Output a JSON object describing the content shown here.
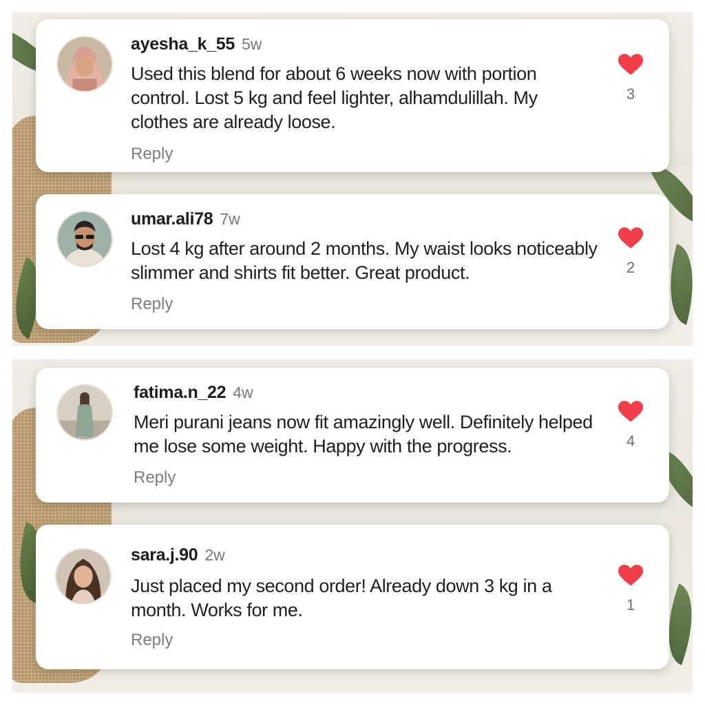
{
  "colors": {
    "heart": "#ef3e4a",
    "username": "#1d1d1d",
    "muted": "#777777"
  },
  "comments": [
    {
      "username": "ayesha_k_55",
      "time": "5w",
      "text": "Used this blend for about 6 weeks now with portion control. Lost 5 kg and feel lighter, alhamdulillah. My clothes are already loose.",
      "reply_label": "Reply",
      "likes": "3",
      "avatar": "woman-headscarf-avatar"
    },
    {
      "username": "umar.ali78",
      "time": "7w",
      "text": "Lost 4 kg after around 2 months. My waist looks noticeably slimmer and shirts fit better. Great product.",
      "reply_label": "Reply",
      "likes": "2",
      "avatar": "man-sunglasses-avatar"
    },
    {
      "username": "fatima.n_22",
      "time": "4w",
      "text": "Meri purani jeans now fit amazingly well. Definitely helped me lose some weight. Happy with the progress.",
      "reply_label": "Reply",
      "likes": "4",
      "avatar": "woman-full-body-avatar"
    },
    {
      "username": "sara.j.90",
      "time": "2w",
      "text": "Just placed my second order! Already down 3 kg in a month. Works for me.",
      "reply_label": "Reply",
      "likes": "1",
      "avatar": "woman-portrait-avatar"
    }
  ]
}
